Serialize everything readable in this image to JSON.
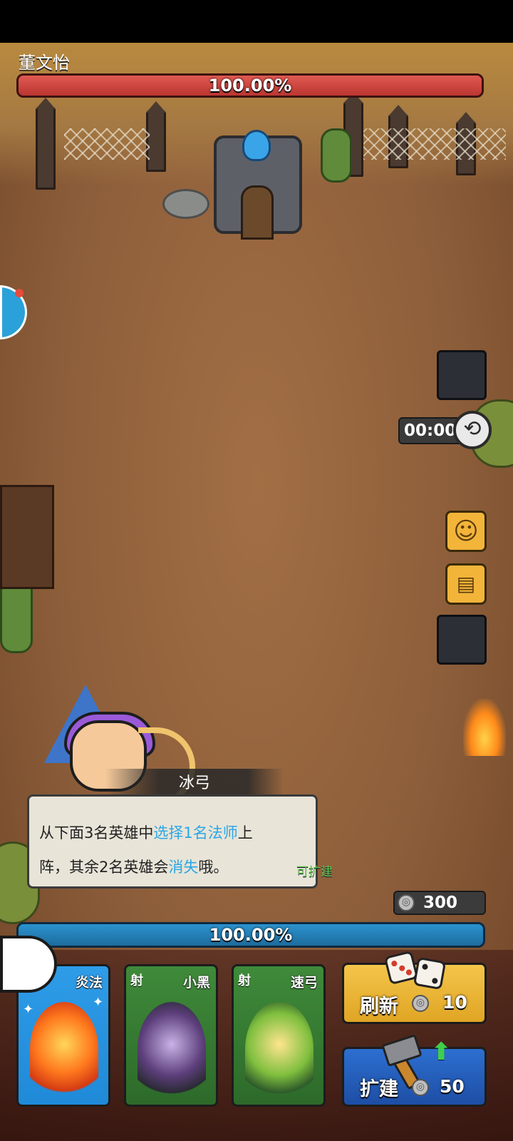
{
  "boss": {
    "name": "董文怡",
    "hp_percent_label": "100.00%",
    "hp_fraction": 1.0
  },
  "timer": {
    "value": "00:00",
    "icon": "history-icon"
  },
  "side_buttons": {
    "emoji_icon": "smiley-icon",
    "chat_icon": "chat-bubble-icon"
  },
  "dialog": {
    "speaker": "冰弓",
    "line1_pre": "从下面3名英雄中",
    "line1_hl": "选择1名法师",
    "line1_post": "上",
    "line2_pre": "阵，其余2名英雄会",
    "line2_hl": "消失",
    "line2_post": "哦。"
  },
  "buildable_hint": "可扩建",
  "coins": {
    "amount": "300",
    "icon": "coin-icon"
  },
  "mana": {
    "percent_label": "100.00%",
    "fraction": 1.0
  },
  "cards": [
    {
      "tag": "",
      "name": "炎法",
      "color": "#2f9ce8",
      "icon": "fire-mage-portrait"
    },
    {
      "tag": "射",
      "name": "小黑",
      "color": "#3f8a3a",
      "icon": "dark-elf-portrait"
    },
    {
      "tag": "射",
      "name": "速弓",
      "color": "#3f8a3a",
      "icon": "green-elf-archer-portrait"
    }
  ],
  "refresh": {
    "label": "刷新",
    "cost": "10",
    "icon": "dice-icon"
  },
  "expand": {
    "label": "扩建",
    "cost": "50",
    "icon": "hammer-icon"
  },
  "colors": {
    "hp_bar": "#d04a45",
    "mana_bar": "#1b6fa6",
    "highlight_text": "#2aa7e6",
    "refresh_button": "#f4c54a",
    "expand_button": "#2c6fd0"
  }
}
